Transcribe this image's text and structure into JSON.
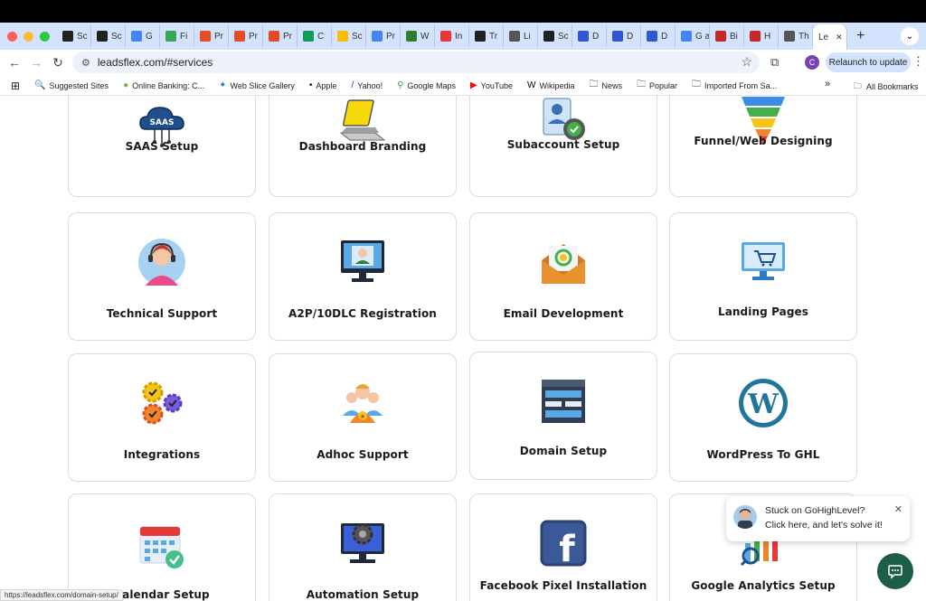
{
  "browser": {
    "tabs": [
      {
        "label": "Sc",
        "color": "#222222"
      },
      {
        "label": "Sc",
        "color": "#222222"
      },
      {
        "label": "G",
        "color": "#4285f4"
      },
      {
        "label": "Fi",
        "color": "#34a853"
      },
      {
        "label": "Pr",
        "color": "#e44d26"
      },
      {
        "label": "Pr",
        "color": "#e44d26"
      },
      {
        "label": "Pr",
        "color": "#e44d26"
      },
      {
        "label": "C",
        "color": "#0f9d58"
      },
      {
        "label": "Sc",
        "color": "#fbbc04"
      },
      {
        "label": "Pr",
        "color": "#4285f4"
      },
      {
        "label": "W",
        "color": "#2e7d32"
      },
      {
        "label": "In",
        "color": "#e53935"
      },
      {
        "label": "Tr",
        "color": "#222222"
      },
      {
        "label": "Li",
        "color": "#555555"
      },
      {
        "label": "Sc",
        "color": "#222222"
      },
      {
        "label": "D",
        "color": "#3056d3"
      },
      {
        "label": "D",
        "color": "#3056d3"
      },
      {
        "label": "D",
        "color": "#3056d3"
      },
      {
        "label": "G ar",
        "color": "#4285f4"
      },
      {
        "label": "Bi",
        "color": "#c62828"
      },
      {
        "label": "H",
        "color": "#c62828"
      },
      {
        "label": "Th",
        "color": "#555555"
      }
    ],
    "active_tab": {
      "label": "Le",
      "close": "✕"
    },
    "new_tab": "+",
    "url": "leadsflex.com/#services",
    "profile_initial": "C",
    "relaunch_label": "Relaunch to update",
    "bookmarks": [
      {
        "label": "Suggested Sites",
        "icon": "search-icon"
      },
      {
        "label": "Online Banking: C...",
        "icon": "bank-icon"
      },
      {
        "label": "Web Slice Gallery",
        "icon": "butterfly-icon"
      },
      {
        "label": "Apple",
        "icon": "apple-icon"
      },
      {
        "label": "Yahoo!",
        "icon": "yahoo-icon"
      },
      {
        "label": "Google Maps",
        "icon": "map-pin-icon"
      },
      {
        "label": "YouTube",
        "icon": "youtube-icon"
      },
      {
        "label": "Wikipedia",
        "icon": "wikipedia-icon"
      },
      {
        "label": "News",
        "icon": "folder-icon"
      },
      {
        "label": "Popular",
        "icon": "folder-icon"
      },
      {
        "label": "Imported From Sa...",
        "icon": "folder-icon"
      }
    ],
    "bookmarks_more": "»",
    "all_bookmarks": "All Bookmarks",
    "status_url": "https://leadsflex.com/domain-setup/"
  },
  "services": [
    {
      "label": "SAAS Setup",
      "icon": "saas-cloud-icon"
    },
    {
      "label": "Dashboard Branding",
      "icon": "laptop-icon"
    },
    {
      "label": "Subaccount Setup",
      "icon": "user-gear-icon"
    },
    {
      "label": "Funnel/Web Designing",
      "icon": "funnel-icon"
    },
    {
      "label": "Technical Support",
      "icon": "headset-agent-icon"
    },
    {
      "label": "A2P/10DLC Registration",
      "icon": "monitor-user-icon"
    },
    {
      "label": "Email Development",
      "icon": "envelope-icon"
    },
    {
      "label": "Landing Pages",
      "icon": "cart-screen-icon"
    },
    {
      "label": "Integrations",
      "icon": "gears-icon"
    },
    {
      "label": "Adhoc Support",
      "icon": "team-icon"
    },
    {
      "label": "Domain Setup",
      "icon": "browser-window-icon"
    },
    {
      "label": "WordPress To GHL",
      "icon": "wordpress-icon"
    },
    {
      "label": "Calendar Setup",
      "icon": "calendar-icon"
    },
    {
      "label": "Automation Setup",
      "icon": "monitor-gear-icon"
    },
    {
      "label": "Facebook Pixel Installation",
      "icon": "facebook-icon"
    },
    {
      "label": "Google Analytics Setup",
      "icon": "analytics-icon"
    }
  ],
  "chat": {
    "line1": "Stuck on GoHighLevel?",
    "line2": "Click here, and let's solve it!",
    "close": "✕"
  }
}
